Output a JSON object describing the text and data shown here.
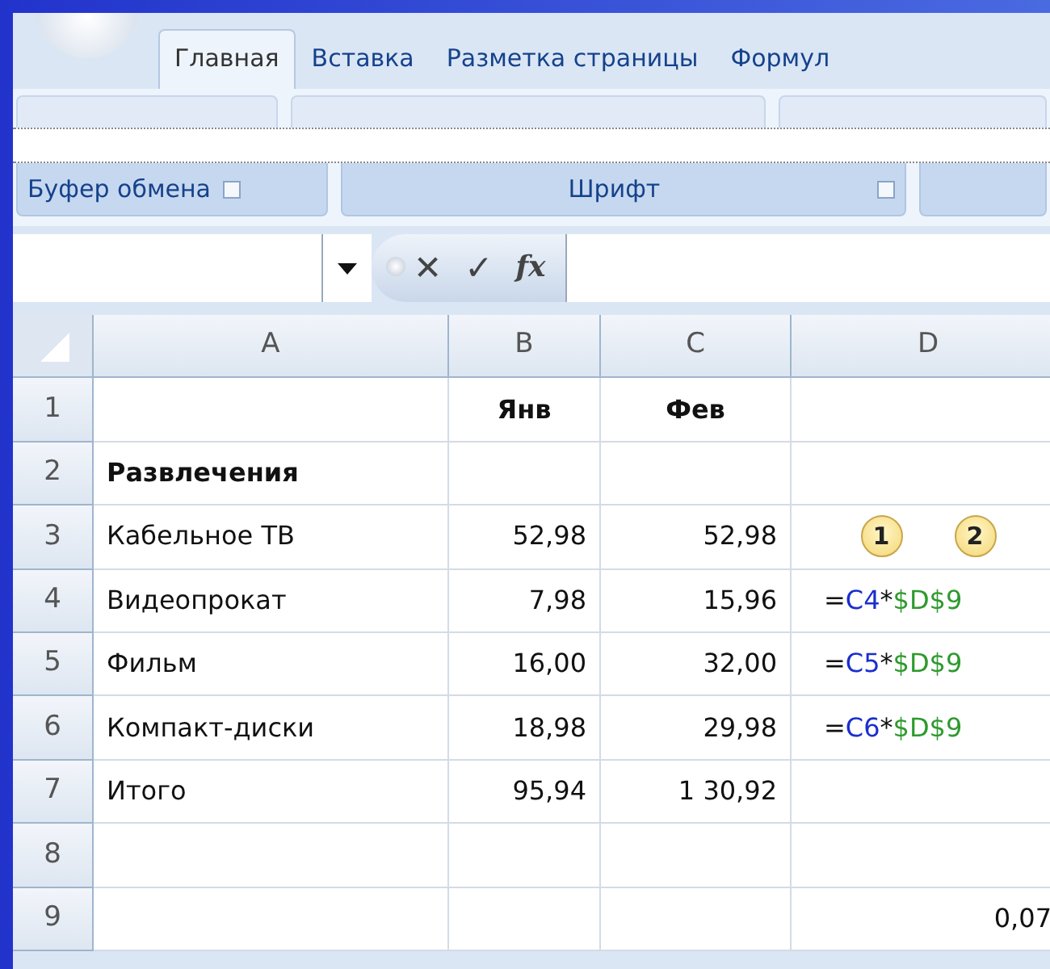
{
  "ribbon": {
    "tabs": [
      {
        "label": "Главная",
        "selected": true
      },
      {
        "label": "Вставка",
        "selected": false
      },
      {
        "label": "Разметка страницы",
        "selected": false
      },
      {
        "label": "Формул",
        "selected": false
      }
    ],
    "groups": [
      {
        "label": "Буфер обмена",
        "launcher": true
      },
      {
        "label": "Шрифт",
        "launcher": true
      }
    ]
  },
  "formula_bar": {
    "cancel": "✕",
    "enter": "✓",
    "function": "fx"
  },
  "sheet": {
    "columns": [
      "A",
      "B",
      "C",
      "D"
    ],
    "rows": [
      {
        "number": "1",
        "cells": [
          {
            "text": ""
          },
          {
            "text": "Янв",
            "bold": true
          },
          {
            "text": "Фев",
            "bold": true
          },
          {
            "text": ""
          }
        ]
      },
      {
        "number": "2",
        "cells": [
          {
            "text": "Развлечения",
            "bold": true
          },
          {
            "text": ""
          },
          {
            "text": ""
          },
          {
            "text": ""
          }
        ]
      },
      {
        "number": "3",
        "cells": [
          {
            "text": "Кабельное ТВ"
          },
          {
            "text": "52,98"
          },
          {
            "text": "52,98"
          },
          {
            "callouts": [
              "1",
              "2"
            ]
          }
        ]
      },
      {
        "number": "4",
        "cells": [
          {
            "text": "Видеопрокат"
          },
          {
            "text": "7,98"
          },
          {
            "text": "15,96"
          },
          {
            "formula": [
              {
                "text": "=",
                "kind": "plain"
              },
              {
                "text": "C4",
                "kind": "relative"
              },
              {
                "text": "*",
                "kind": "plain"
              },
              {
                "text": "$D$9",
                "kind": "absolute"
              }
            ]
          }
        ]
      },
      {
        "number": "5",
        "cells": [
          {
            "text": "Фильм"
          },
          {
            "text": "16,00"
          },
          {
            "text": "32,00"
          },
          {
            "formula": [
              {
                "text": "=",
                "kind": "plain"
              },
              {
                "text": "C5",
                "kind": "relative"
              },
              {
                "text": "*",
                "kind": "plain"
              },
              {
                "text": "$D$9",
                "kind": "absolute"
              }
            ]
          }
        ]
      },
      {
        "number": "6",
        "cells": [
          {
            "text": "Компакт-диски"
          },
          {
            "text": "18,98"
          },
          {
            "text": "29,98"
          },
          {
            "formula": [
              {
                "text": "=",
                "kind": "plain"
              },
              {
                "text": "C6",
                "kind": "relative"
              },
              {
                "text": "*",
                "kind": "plain"
              },
              {
                "text": "$D$9",
                "kind": "absolute"
              }
            ]
          }
        ]
      },
      {
        "number": "7",
        "cells": [
          {
            "text": "Итого"
          },
          {
            "text": "95,94"
          },
          {
            "text": "1 30,92"
          },
          {
            "text": ""
          }
        ]
      },
      {
        "number": "8",
        "cells": [
          {
            "text": ""
          },
          {
            "text": ""
          },
          {
            "text": ""
          },
          {
            "text": ""
          }
        ]
      },
      {
        "number": "9",
        "cells": [
          {
            "text": ""
          },
          {
            "text": ""
          },
          {
            "text": ""
          },
          {
            "text": "0,07"
          }
        ]
      }
    ]
  }
}
